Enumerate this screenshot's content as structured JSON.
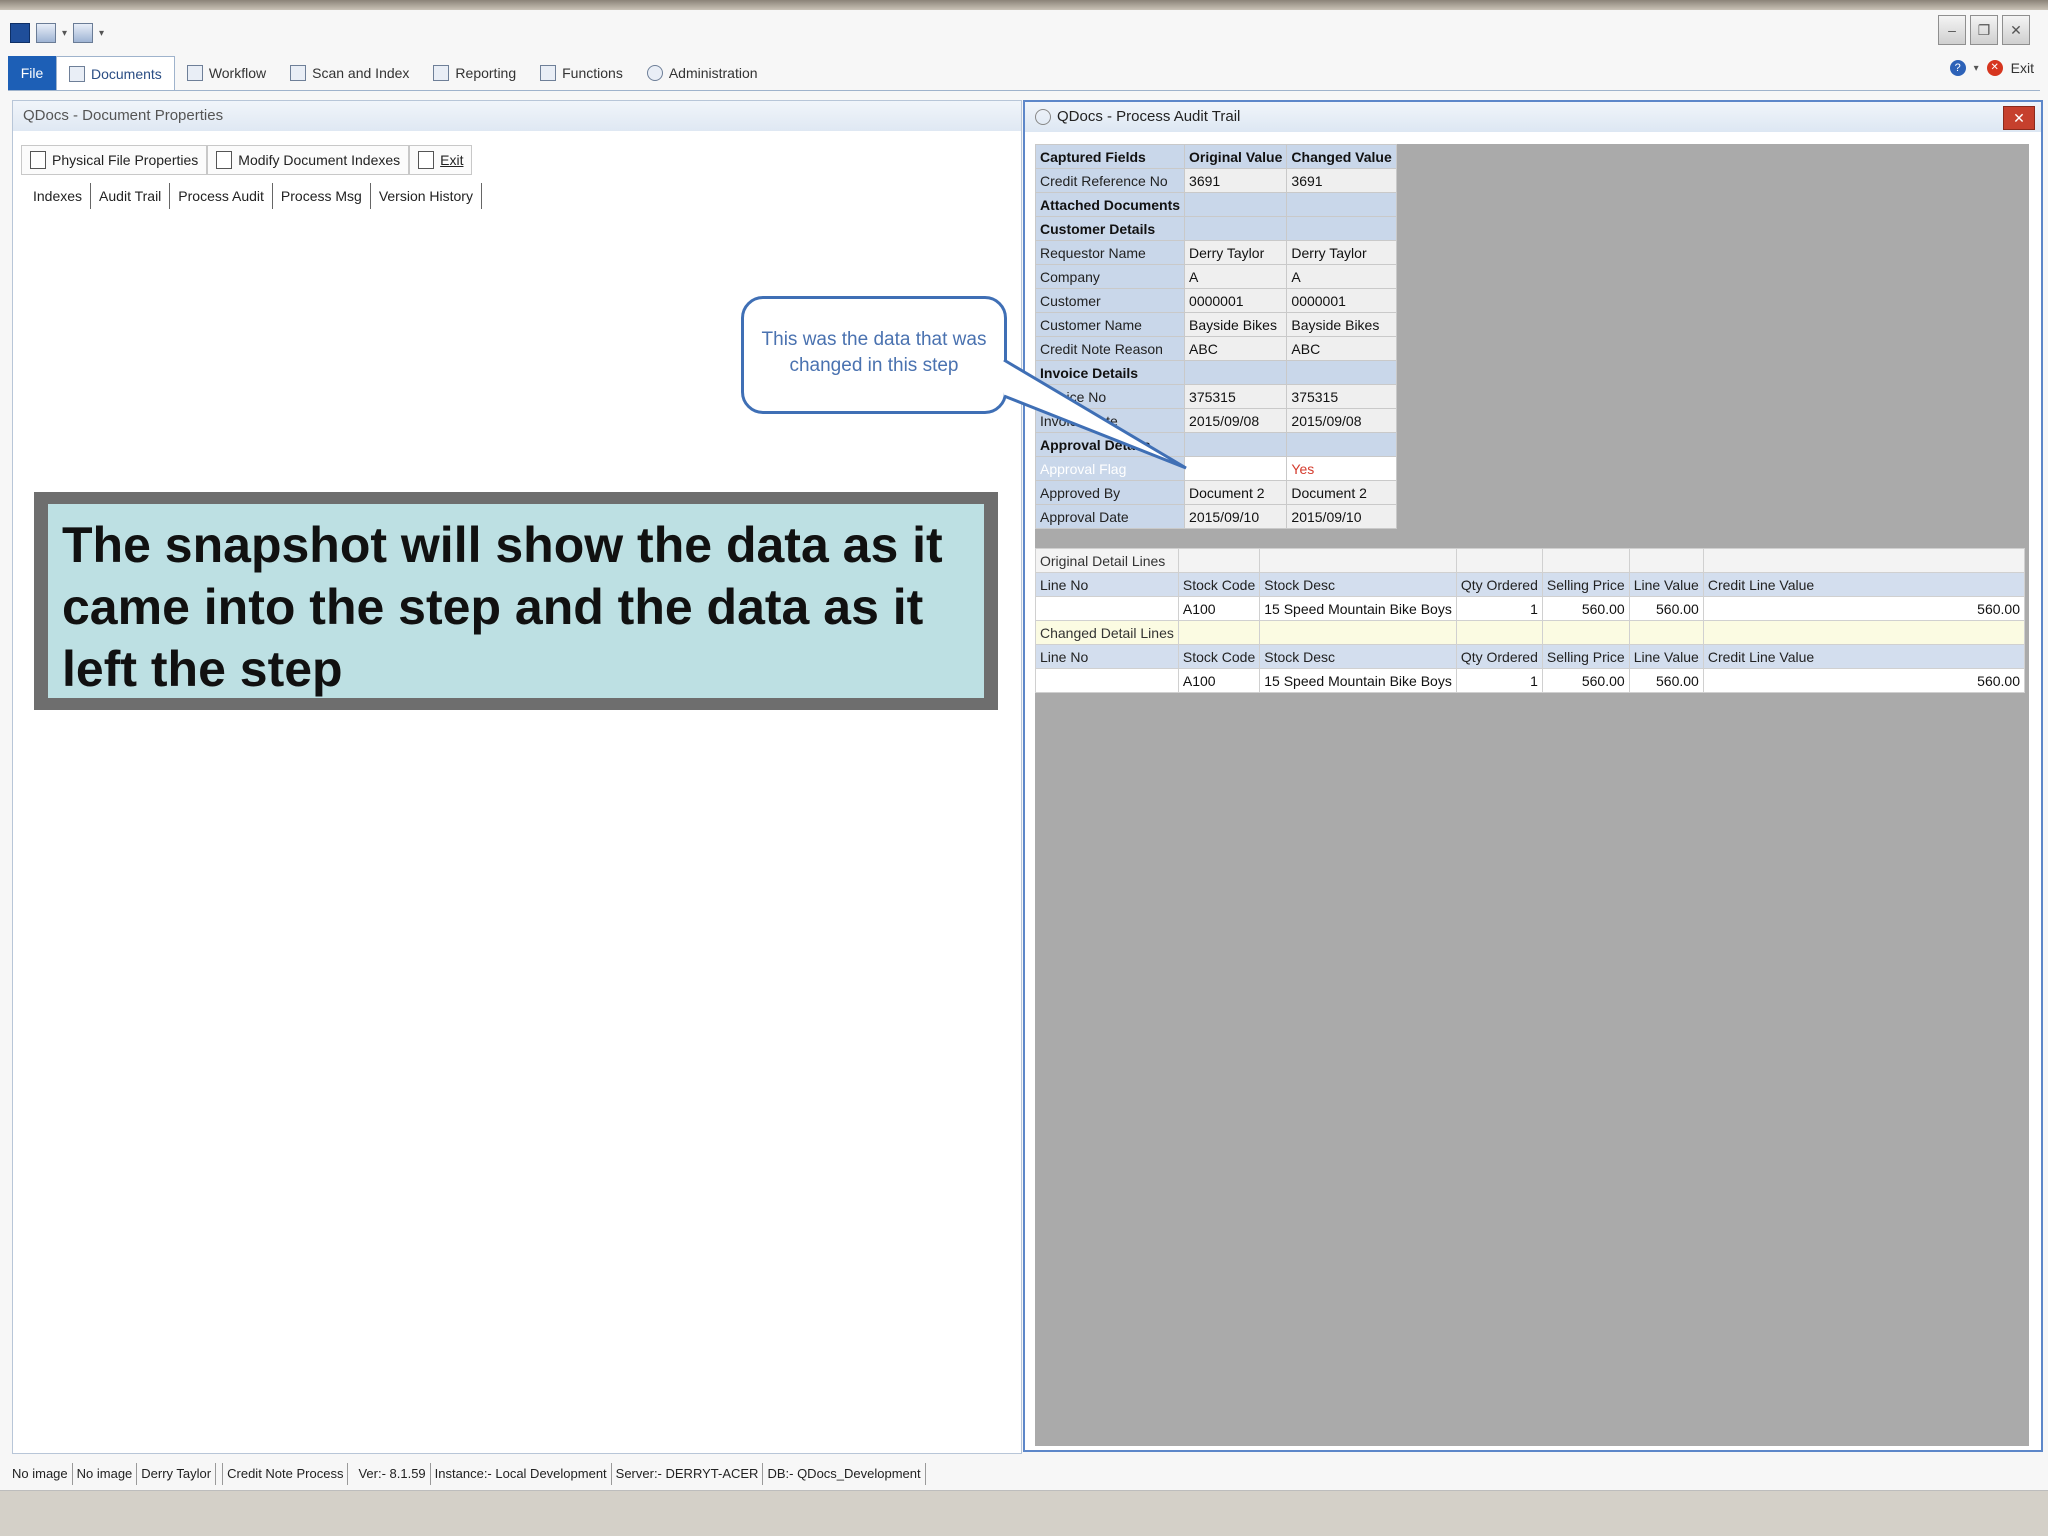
{
  "ribbon": {
    "file": "File",
    "tabs": [
      {
        "label": "Documents"
      },
      {
        "label": "Workflow"
      },
      {
        "label": "Scan and Index"
      },
      {
        "label": "Reporting"
      },
      {
        "label": "Functions"
      },
      {
        "label": "Administration"
      }
    ],
    "exit": "Exit"
  },
  "left": {
    "title": "QDocs - Document Properties",
    "toolbar": [
      "Physical File Properties",
      "Modify Document Indexes",
      "Exit"
    ],
    "tabs": [
      "Indexes",
      "Audit Trail",
      "Process Audit",
      "Process Msg",
      "Version History"
    ]
  },
  "callout": {
    "text": "This was the data that was changed in this step"
  },
  "note": {
    "text": "The snapshot will show the data as it came into the step and the data as it left the step"
  },
  "right": {
    "title": "QDocs - Process Audit Trail",
    "captured": {
      "headers": [
        "Captured Fields",
        "Original Value",
        "Changed Value"
      ],
      "rows": [
        {
          "kind": "row",
          "field": "Credit Reference No",
          "orig": "3691",
          "changed": "3691"
        },
        {
          "kind": "sec",
          "field": "Attached Documents",
          "orig": "",
          "changed": ""
        },
        {
          "kind": "sec",
          "field": "Customer Details",
          "orig": "",
          "changed": ""
        },
        {
          "kind": "row",
          "field": "Requestor Name",
          "orig": "Derry Taylor",
          "changed": "Derry Taylor"
        },
        {
          "kind": "row",
          "field": "Company",
          "orig": "A",
          "changed": "A"
        },
        {
          "kind": "row",
          "field": "Customer",
          "orig": "0000001",
          "changed": "0000001"
        },
        {
          "kind": "row",
          "field": "Customer Name",
          "orig": "Bayside Bikes",
          "changed": "Bayside Bikes"
        },
        {
          "kind": "row",
          "field": "Credit Note Reason",
          "orig": "ABC",
          "changed": "ABC"
        },
        {
          "kind": "sec",
          "field": "Invoice Details",
          "orig": "",
          "changed": ""
        },
        {
          "kind": "row",
          "field": "Invoice No",
          "orig": "375315",
          "changed": "375315"
        },
        {
          "kind": "row",
          "field": "Invoice Date",
          "orig": "2015/09/08",
          "changed": "2015/09/08"
        },
        {
          "kind": "sec",
          "field": "Approval Details",
          "orig": "",
          "changed": ""
        },
        {
          "kind": "hl",
          "field": "Approval Flag",
          "orig": "",
          "changed": "Yes"
        },
        {
          "kind": "row",
          "field": "Approved By",
          "orig": "Document 2",
          "changed": "Document 2"
        },
        {
          "kind": "row",
          "field": "Approval Date",
          "orig": "2015/09/10",
          "changed": "2015/09/10"
        }
      ]
    },
    "detail": {
      "original_label": "Original Detail Lines",
      "changed_label": "Changed Detail Lines",
      "headers": [
        "Line No",
        "Stock Code",
        "Stock Desc",
        "Qty Ordered",
        "Selling Price",
        "Line Value",
        "Credit Line Value"
      ],
      "original_row": [
        "",
        "A100",
        "15 Speed Mountain Bike Boys",
        "1",
        "560.00",
        "560.00",
        "560.00"
      ],
      "changed_row": [
        "",
        "A100",
        "15 Speed Mountain Bike Boys",
        "1",
        "560.00",
        "560.00",
        "560.00"
      ]
    }
  },
  "status": [
    "No image",
    "No image",
    "Derry Taylor",
    "Credit Note Process",
    "Ver:- 8.1.59",
    "Instance:- Local Development",
    "Server:- DERRYT-ACER",
    "DB:- QDocs_Development"
  ]
}
